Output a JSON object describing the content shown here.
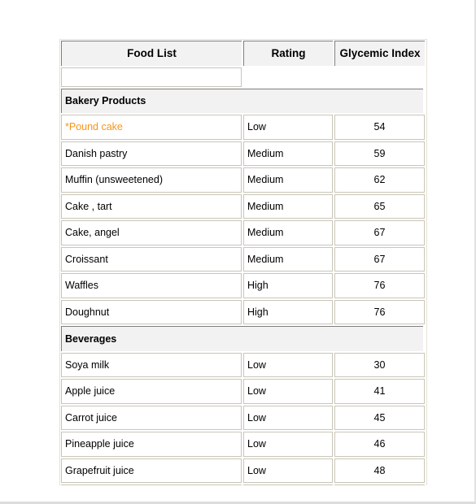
{
  "table": {
    "headers": [
      "Food List",
      "Rating",
      "Glycemic Index"
    ],
    "sections": [
      {
        "title": "Bakery Products",
        "rows": [
          {
            "food": "*Pound cake",
            "rating": "Low",
            "gi": "54",
            "highlight": "#f7941d"
          },
          {
            "food": "Danish pastry",
            "rating": "Medium",
            "gi": "59"
          },
          {
            "food": "Muffin (unsweetened)",
            "rating": "Medium",
            "gi": "62"
          },
          {
            "food": "Cake , tart",
            "rating": "Medium",
            "gi": "65"
          },
          {
            "food": "Cake, angel",
            "rating": "Medium",
            "gi": "67"
          },
          {
            "food": "Croissant",
            "rating": "Medium",
            "gi": "67"
          },
          {
            "food": "Waffles",
            "rating": "High",
            "gi": "76"
          },
          {
            "food": "Doughnut",
            "rating": "High",
            "gi": "76"
          }
        ]
      },
      {
        "title": "Beverages",
        "rows": [
          {
            "food": "Soya milk",
            "rating": "Low",
            "gi": "30"
          },
          {
            "food": "Apple juice",
            "rating": "Low",
            "gi": "41"
          },
          {
            "food": "Carrot juice",
            "rating": "Low",
            "gi": "45"
          },
          {
            "food": "Pineapple juice",
            "rating": "Low",
            "gi": "46"
          },
          {
            "food": "Grapefruit juice",
            "rating": "Low",
            "gi": "48"
          },
          {
            "food": "",
            "rating": "",
            "gi": ""
          }
        ]
      }
    ]
  }
}
